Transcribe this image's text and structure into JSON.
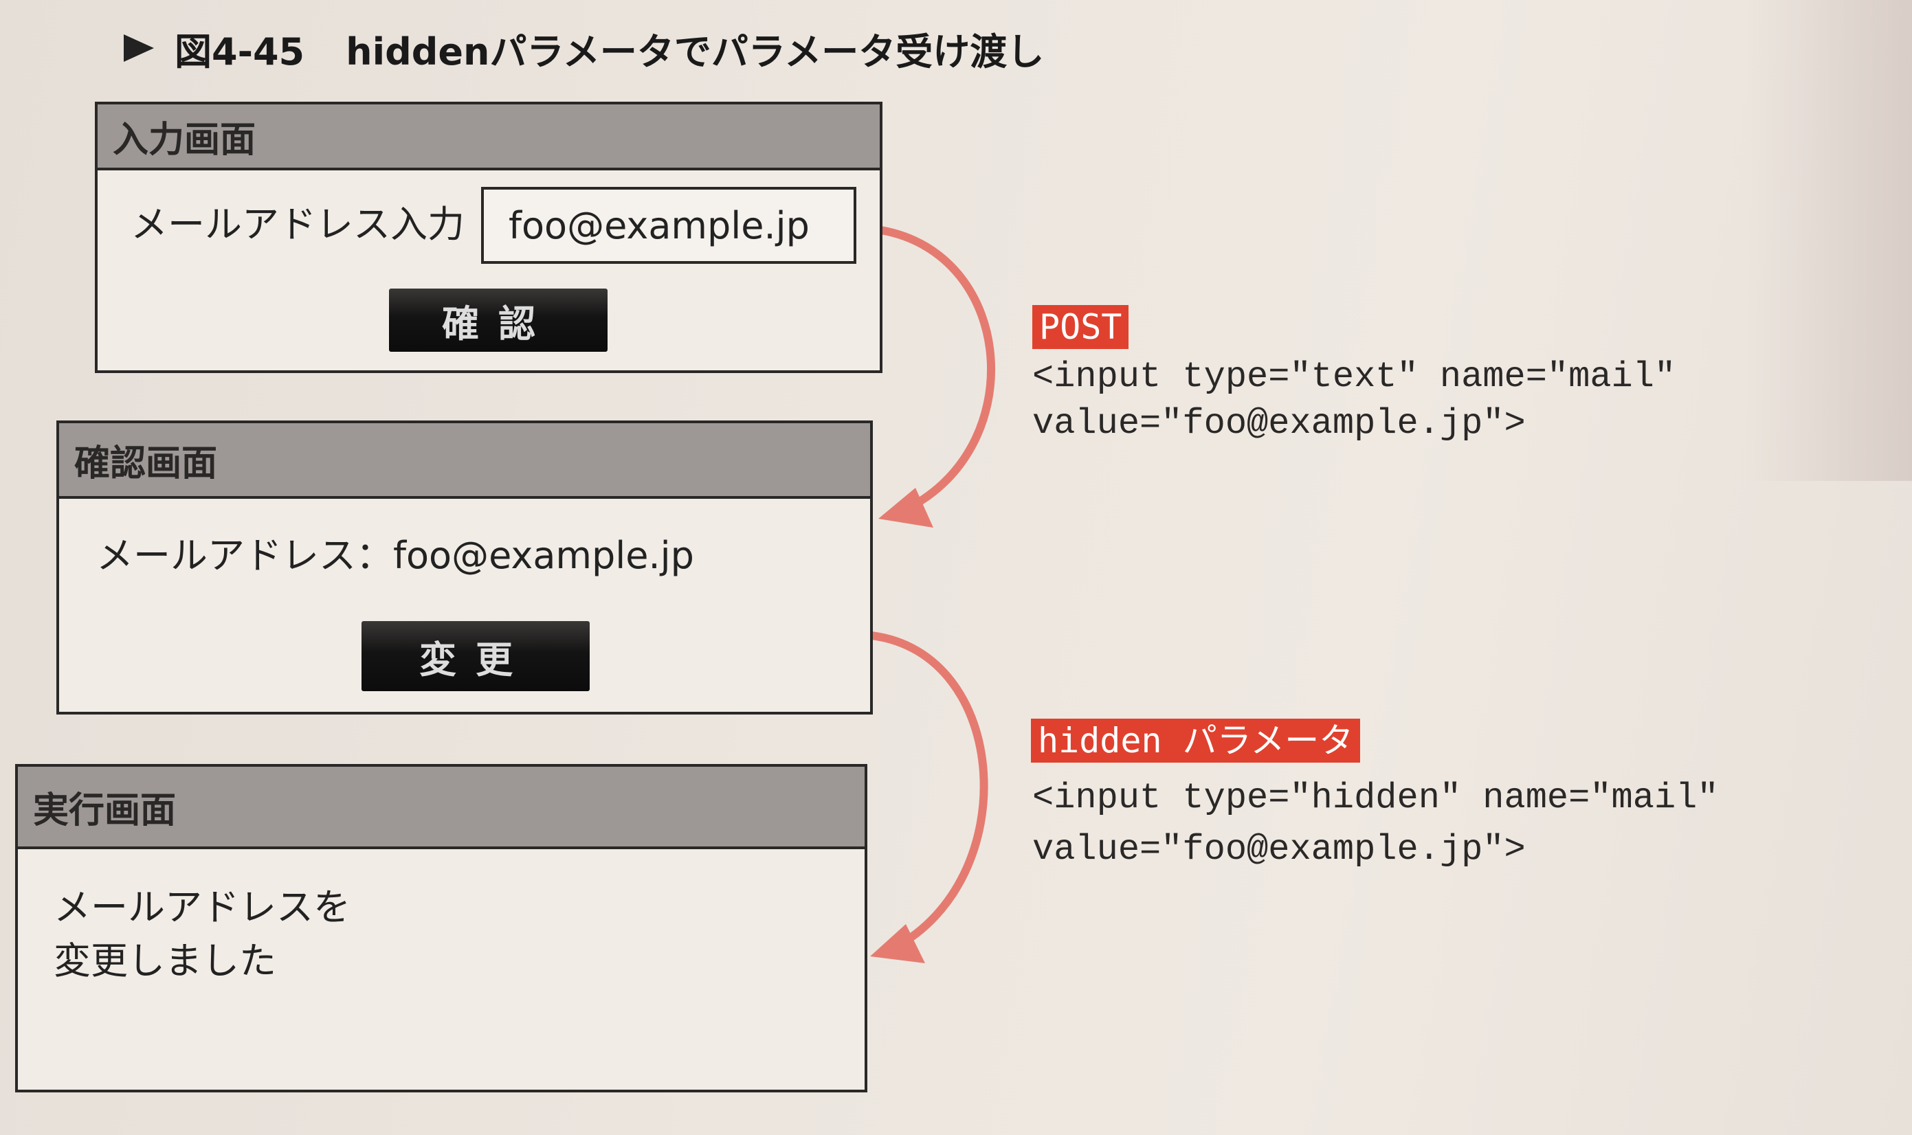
{
  "figure": {
    "number": "図4-45",
    "title": "hiddenパラメータでパラメータ受け渡し"
  },
  "screens": {
    "input": {
      "title": "入力画面",
      "field_label": "メールアドレス入力",
      "field_value": "foo@example.jp",
      "button_label": "確認"
    },
    "confirm": {
      "title": "確認画面",
      "text": "メールアドレス：foo@example.jp",
      "button_label": "変更"
    },
    "execute": {
      "title": "実行画面",
      "message_line1": "メールアドレスを",
      "message_line2": "変更しました"
    }
  },
  "transitions": [
    {
      "tag": "POST",
      "code_line1": "<input type=\"text\" name=\"mail\"",
      "code_line2": "value=\"foo@example.jp\">"
    },
    {
      "tag": "hidden パラメータ",
      "code_line1": "<input type=\"hidden\" name=\"mail\"",
      "code_line2": "value=\"foo@example.jp\">"
    }
  ],
  "colors": {
    "accent": "#e0412e",
    "arrow": "#e57b70",
    "header": "#9d9896"
  }
}
